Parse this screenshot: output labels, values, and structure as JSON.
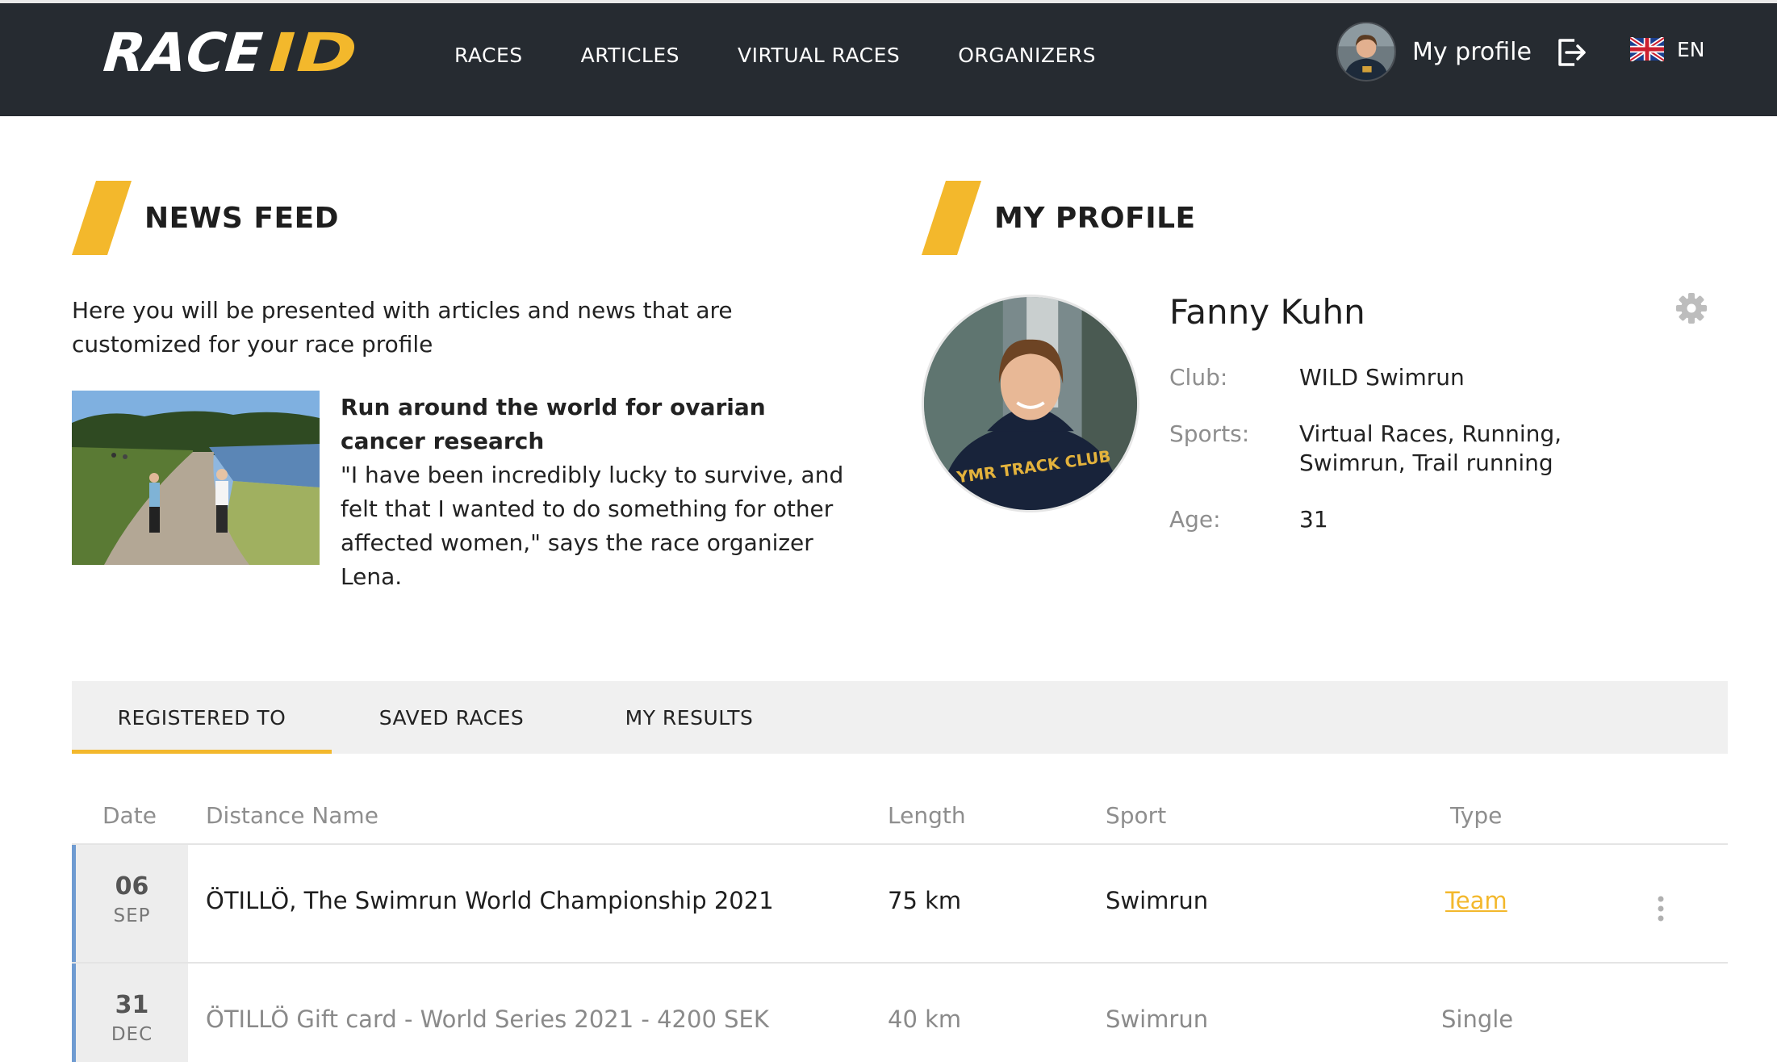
{
  "header": {
    "logo_text": "RACEID",
    "nav": [
      "RACES",
      "ARTICLES",
      "VIRTUAL RACES",
      "ORGANIZERS"
    ],
    "profile_label": "My profile",
    "language": "EN"
  },
  "news": {
    "heading": "NEWS FEED",
    "intro": "Here you will be presented with articles and news that are customized for your race profile",
    "article": {
      "title": "Run around the world for ovarian cancer research",
      "excerpt": "\"I have been incredibly lucky to survive, and felt that I wanted to do something for other affected women,\" says the race organizer Lena."
    }
  },
  "profile": {
    "heading": "MY PROFILE",
    "name": "Fanny Kuhn",
    "photo_text": "YMR TRACK CLUB",
    "club_label": "Club:",
    "club": "WILD Swimrun",
    "sports_label": "Sports:",
    "sports": "Virtual Races, Running, Swimrun, Trail running",
    "age_label": "Age:",
    "age": "31"
  },
  "tabs": [
    {
      "label": "REGISTERED TO",
      "active": true
    },
    {
      "label": "SAVED RACES",
      "active": false
    },
    {
      "label": "MY RESULTS",
      "active": false
    }
  ],
  "table": {
    "columns": [
      "Date",
      "Distance Name",
      "Length",
      "Sport",
      "Type"
    ],
    "rows": [
      {
        "day": "06",
        "month": "SEP",
        "name": "ÖTILLÖ, The Swimrun World Championship 2021",
        "length": "75 km",
        "sport": "Swimrun",
        "type": "Team",
        "type_is_link": true
      },
      {
        "day": "31",
        "month": "DEC",
        "name": "ÖTILLÖ Gift card - World Series 2021 - 4200 SEK",
        "length": "40 km",
        "sport": "Swimrun",
        "type": "Single",
        "type_is_link": false
      }
    ]
  },
  "colors": {
    "header_bg": "#262b31",
    "accent": "#f3b82c",
    "date_bar": "#6f9bd1",
    "tab_bg": "#f0f0f0"
  }
}
